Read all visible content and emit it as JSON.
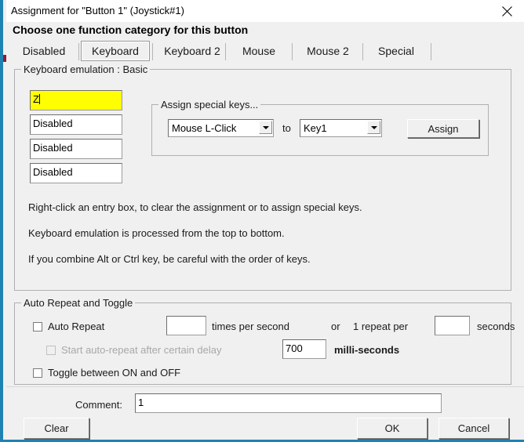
{
  "window": {
    "title": "Assignment for \"Button 1\" (Joystick#1)",
    "close_icon": "close-icon",
    "accent_color": "#1e83b3",
    "background_color": "#f0f0f0"
  },
  "heading": "Choose one function category for this button",
  "tabs": [
    {
      "label": "Disabled",
      "selected": false
    },
    {
      "label": "Keyboard",
      "selected": true
    },
    {
      "label": "Keyboard 2",
      "selected": false
    },
    {
      "label": "Mouse",
      "selected": false
    },
    {
      "label": "Mouse 2",
      "selected": false
    },
    {
      "label": "Special",
      "selected": false
    }
  ],
  "keyboard_group": {
    "label": "Keyboard emulation : Basic",
    "entries": [
      {
        "value": "Z",
        "highlight": true,
        "highlight_color": "#ffff00",
        "has_caret": true
      },
      {
        "value": "Disabled",
        "highlight": false,
        "has_caret": false
      },
      {
        "value": "Disabled",
        "highlight": false,
        "has_caret": false
      },
      {
        "value": "Disabled",
        "highlight": false,
        "has_caret": false
      }
    ],
    "special_keys": {
      "label": "Assign special keys...",
      "source_value": "Mouse L-Click",
      "to_label": "to",
      "target_value": "Key1",
      "assign_button": "Assign",
      "arrow_icon": "chevron-down-icon"
    },
    "hints": [
      "Right-click an entry box, to clear the assignment or to assign special keys.",
      "Keyboard emulation is processed from the top to bottom.",
      "If you combine Alt or Ctrl key, be careful with the order of keys."
    ]
  },
  "auto_repeat_group": {
    "label": "Auto Repeat and Toggle",
    "auto_repeat_checkbox": {
      "label": "Auto Repeat",
      "checked": false,
      "disabled": false
    },
    "times_per_second_value": "",
    "times_per_second_label": "times per second",
    "or_label": "or",
    "one_repeat_per_label": "1 repeat per",
    "seconds_value": "",
    "seconds_label": "seconds",
    "delay_checkbox": {
      "label": "Start auto-repeat after certain delay",
      "checked": false,
      "disabled": true
    },
    "delay_value": "700",
    "delay_units_label": "milli-seconds",
    "toggle_checkbox": {
      "label": "Toggle between ON and OFF",
      "checked": false,
      "disabled": false
    }
  },
  "footer": {
    "comment_label": "Comment:",
    "comment_value": "1",
    "comment_placeholder": "",
    "clear_button": "Clear",
    "ok_button": "OK",
    "cancel_button": "Cancel"
  }
}
